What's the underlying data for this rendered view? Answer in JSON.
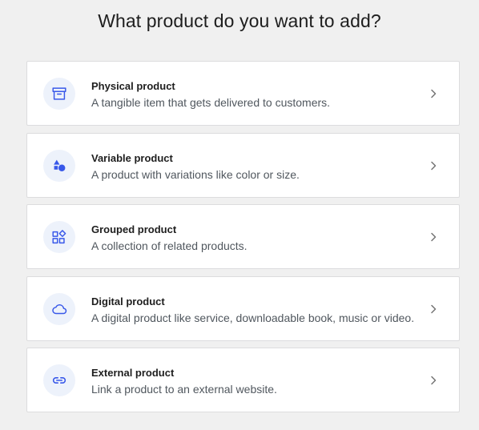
{
  "page": {
    "title": "What product do you want to add?"
  },
  "colors": {
    "accent": "#3858e9",
    "icon_background": "#edf2fb",
    "page_background": "#f0f0f0",
    "card_background": "#ffffff",
    "card_border": "#dcdcde",
    "description_text": "#50575e",
    "chevron": "#757575"
  },
  "options": [
    {
      "icon": "archive-box-icon",
      "title": "Physical product",
      "description": "A tangible item that gets delivered to customers."
    },
    {
      "icon": "shapes-icon",
      "title": "Variable product",
      "description": "A product with variations like color or size."
    },
    {
      "icon": "blocks-grid-icon",
      "title": "Grouped product",
      "description": "A collection of related products."
    },
    {
      "icon": "cloud-icon",
      "title": "Digital product",
      "description": "A digital product like service, downloadable book, music or video."
    },
    {
      "icon": "link-icon",
      "title": "External product",
      "description": "Link a product to an external website."
    }
  ]
}
